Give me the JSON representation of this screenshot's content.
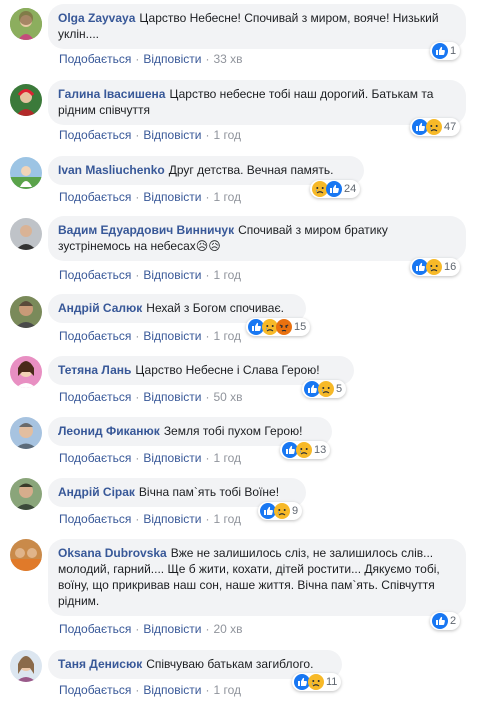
{
  "actions": {
    "like": "Подобається",
    "reply": "Відповісти",
    "sep": "·"
  },
  "comments": [
    {
      "author": "Olga Zayvaya",
      "text": "Царство Небесне! Спочивай з миром, вояче! Низький уклін....",
      "reactions": [
        "like"
      ],
      "count": "1",
      "time": "33 хв"
    },
    {
      "author": "Галина Івасишена",
      "text": "Царство небесне тобі наш дорогий. Батькам та рідним співчуття",
      "reactions": [
        "like",
        "sad"
      ],
      "count": "47",
      "time": "1 год"
    },
    {
      "author": "Ivan Masliuchenko",
      "text": "Друг детства. Вечная память.",
      "reactions": [
        "sad",
        "like"
      ],
      "count": "24",
      "time": "1 год"
    },
    {
      "author": "Вадим Едуардович Винничук",
      "text": "Спочивай з миром братику зустрінемось на небесах😥😥",
      "reactions": [
        "like",
        "sad"
      ],
      "count": "16",
      "time": "1 год"
    },
    {
      "author": "Андрій Салюк",
      "text": "Нехай з Богом спочиває.",
      "reactions": [
        "like",
        "sad",
        "angry"
      ],
      "count": "15",
      "time": "1 год"
    },
    {
      "author": "Тетяна Лань",
      "text": "Царство Небесне і Слава Герою!",
      "reactions": [
        "like",
        "sad"
      ],
      "count": "5",
      "time": "50 хв"
    },
    {
      "author": "Леонид Фиканюк",
      "text": "Земля тобі пухом Герою!",
      "reactions": [
        "like",
        "sad"
      ],
      "count": "13",
      "time": "1 год"
    },
    {
      "author": "Андрій Сірак",
      "text": "Вічна пам`ять тобі Воїне!",
      "reactions": [
        "like",
        "sad"
      ],
      "count": "9",
      "time": "1 год"
    },
    {
      "author": "Oksana Dubrovska",
      "text": "Вже не залишилось сліз, не залишилось слів... молодий, гарний.... Ще б жити, кохати, дітей ростити... Дякуємо тобі, воїну, що прикривав наш сон, наше життя. Вічна пам`ять. Співчуття рідним.",
      "reactions": [
        "like"
      ],
      "count": "2",
      "time": "20 хв"
    },
    {
      "author": "Таня Денисюк",
      "text": "Співчуваю батькам загиблого.",
      "reactions": [
        "like",
        "sad"
      ],
      "count": "11",
      "time": "1 год"
    }
  ],
  "colors": {
    "author": "#385898",
    "bubble": "#f2f3f5",
    "like": "#1877f2",
    "sad": "#f7b928",
    "angry": "#e9710f"
  }
}
